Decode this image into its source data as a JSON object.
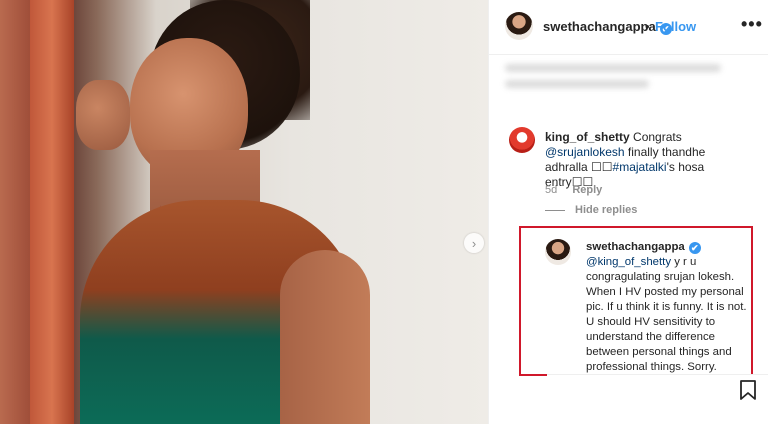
{
  "post": {
    "username": "swethachangappa",
    "verified_mark": "✔",
    "separator": "•",
    "follow_label": "Follow",
    "more_label": "•••"
  },
  "comments": [
    {
      "username": "king_of_shetty",
      "text_start": " Congrats ",
      "mention": "@srujanlokesh",
      "text_mid": " finally thandhe adhralla ",
      "emoji1": "☐☐",
      "hashtag": "#majatalki",
      "text_end": "'s hosa entry",
      "emoji2": "☐☐",
      "age": "5d",
      "reply_label": "Reply",
      "hide_replies_label": "Hide replies"
    }
  ],
  "reply": {
    "username": "swethachangappa",
    "verified_mark": "✔",
    "mention": "@king_of_shetty",
    "text": " y r u congragulating srujan lokesh. When I HV posted my personal pic. If u think it is funny. It is not. U should HV sensitivity to understand the difference between personal things and professional things. Sorry."
  },
  "icons": {
    "next": "chevron-right-icon",
    "bookmark": "bookmark-icon"
  },
  "colors": {
    "accent": "#3897f0",
    "highlight_border": "#d0182b",
    "link": "#00376b",
    "muted": "#8e8e8e"
  },
  "next_glyph": "›"
}
